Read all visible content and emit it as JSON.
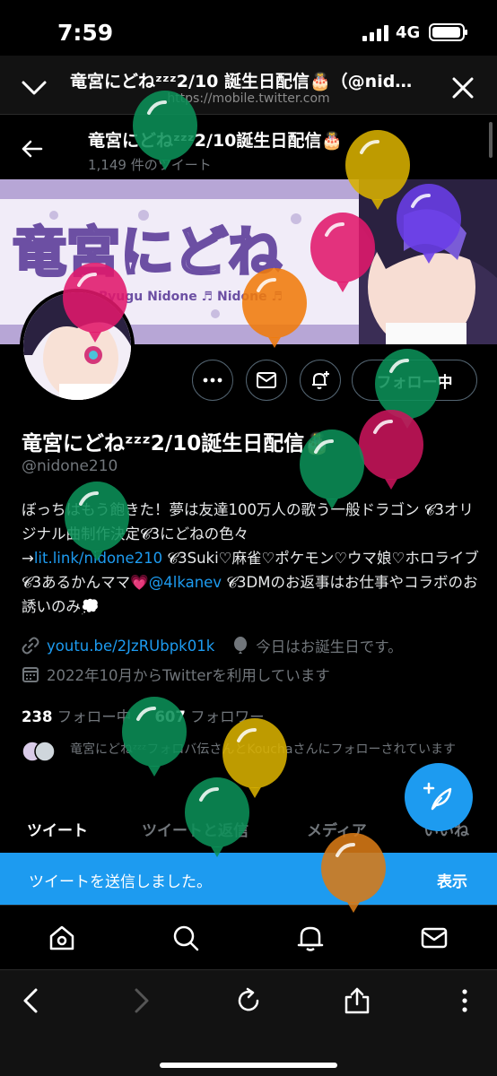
{
  "status_bar": {
    "time": "7:59",
    "network": "4G",
    "battery_level": 0.85
  },
  "browser": {
    "title": "竜宮にどねᶻᶻᶻ2/10 誕生日配信🎂（@nid…",
    "url": "https://mobile.twitter.com"
  },
  "profile": {
    "top_name": "竜宮にどねᶻᶻᶻ2/10誕生日配信🎂",
    "tweet_count": "1,149 件のツイート",
    "display_name": "竜宮にどねᶻᶻᶻ2/10誕生日配信🎂",
    "handle": "@nidone210",
    "following_label": "フォロー中",
    "bio_1": "ぼっちはもう飽きた！夢は友達100万人の歌う一般ドラゴン",
    "bio_2": "𝓒3オリジナル曲制作決定𝓒3にどねの色々",
    "bio_arrow": "→",
    "bio_link": "lit.link/nidone210",
    "bio_3": " 𝓒3Suki♡麻雀♡ポケモン♡ウマ娘♡ホロライブ𝓒3あるかんママ💗",
    "bio_mention": "@4lkanev",
    "bio_4": " 𝓒3DMのお返事はお仕事やコラボのお誘いのみ💭",
    "website": "youtu.be/2JzRUbpk01k",
    "birthday": "今日はお誕生日です。",
    "joined": "2022年10月からTwitterを利用しています",
    "following_count": "238",
    "following_label_text": "フォロー中",
    "followers_count": "607",
    "followers_label": "フォロワー",
    "followed_by": "竜宮にどねᶻᶻᶻフォロバ伝さんとKouchaさんにフォローされています"
  },
  "tabs": [
    "ツイート",
    "ツイートと返信",
    "メディア",
    "いいね"
  ],
  "toast": {
    "message": "ツイートを送信しました。",
    "action": "表示"
  },
  "banner_text": "竜宮にどね",
  "banner_sub": "Ryugu Nidone ♬ Nidone ♬",
  "icons": {
    "nav": [
      "home-icon",
      "search-icon",
      "bell-icon",
      "mail-icon"
    ],
    "toolbar": [
      "back-arrow-icon",
      "forward-arrow-icon",
      "reload-icon",
      "share-icon",
      "more-vertical-icon"
    ]
  },
  "colors": {
    "accent": "#1d9bf0",
    "background": "#000000",
    "muted": "#71767b"
  }
}
